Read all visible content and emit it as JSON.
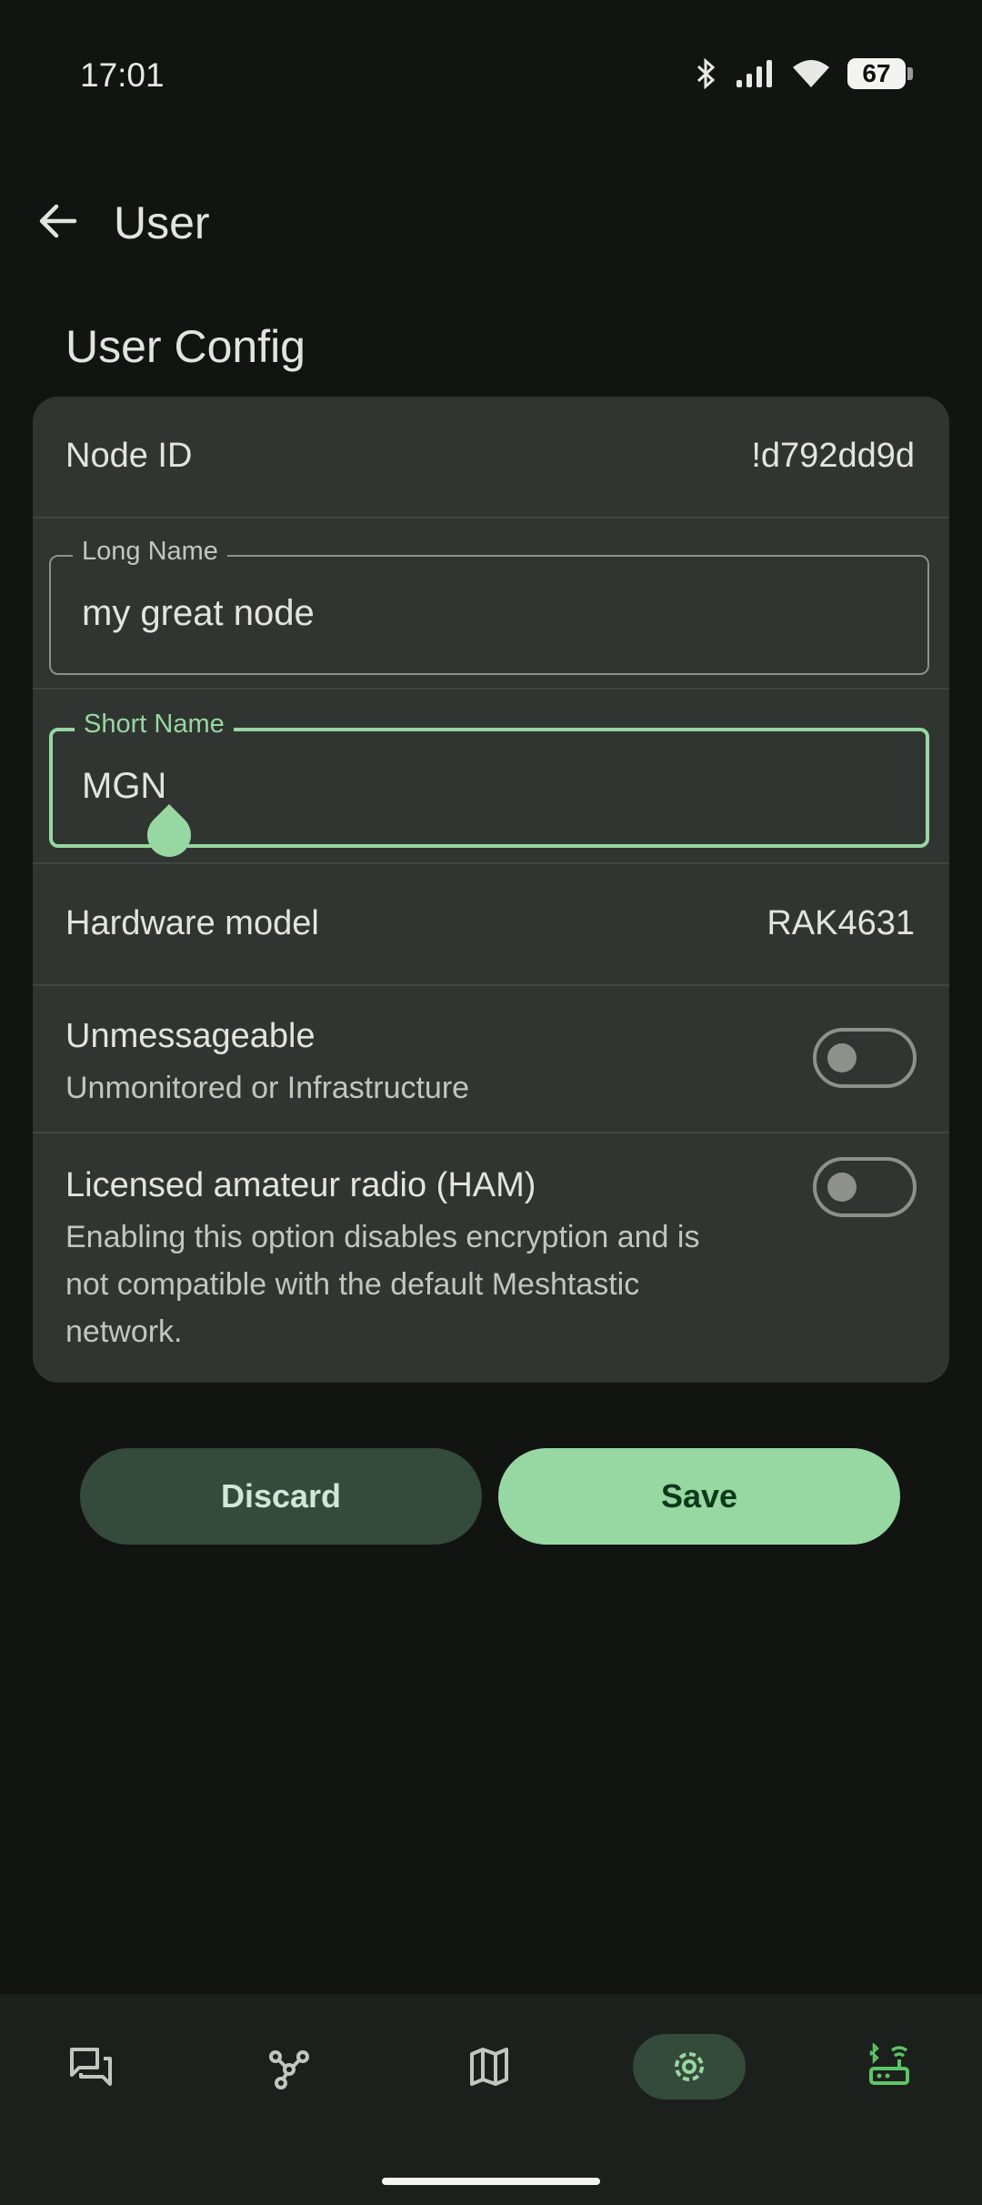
{
  "status_bar": {
    "time": "17:01",
    "battery": "67"
  },
  "app_bar": {
    "title": "User"
  },
  "section": {
    "title": "User Config"
  },
  "node_id": {
    "label": "Node ID",
    "value": "!d792dd9d"
  },
  "long_name": {
    "label": "Long Name",
    "value": "my great node"
  },
  "short_name": {
    "label": "Short Name",
    "value": "MGN"
  },
  "hardware": {
    "label": "Hardware model",
    "value": "RAK4631"
  },
  "unmessageable": {
    "title": "Unmessageable",
    "subtitle": "Unmonitored or Infrastructure",
    "enabled": false
  },
  "ham": {
    "title": "Licensed amateur radio (HAM)",
    "line1": "Enabling this option disables encryption and is",
    "line2": "not compatible with the default Meshtastic",
    "line3": "network.",
    "enabled": false
  },
  "buttons": {
    "discard": "Discard",
    "save": "Save"
  },
  "colors": {
    "background": "#111411",
    "card": "#313531",
    "accent": "#97d7a2",
    "nav_active": "#344a3a"
  },
  "bottom_nav": {
    "items": [
      "messages-icon",
      "nodes-icon",
      "map-icon",
      "settings-icon",
      "bluetooth-router-icon"
    ],
    "active": "settings-icon"
  }
}
